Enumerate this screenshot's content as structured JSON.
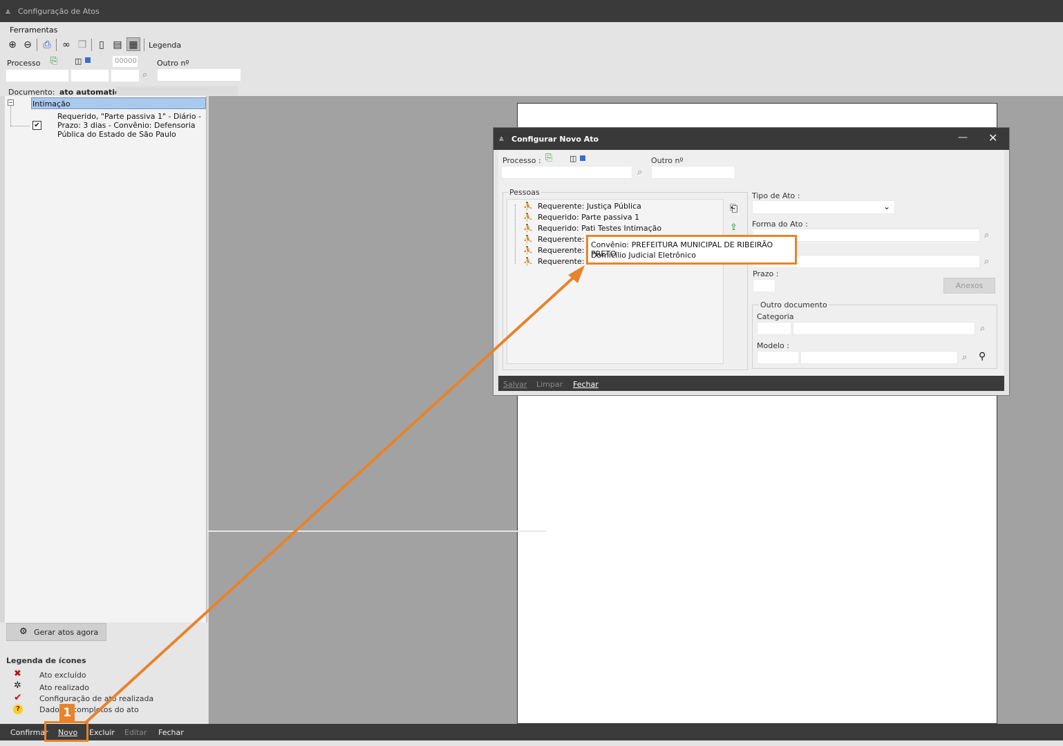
{
  "window": {
    "title": "Configuração de Atos"
  },
  "menu": {
    "ferramentas": "Ferramentas"
  },
  "toolbar": {
    "legend_label": "Legenda"
  },
  "search": {
    "processo_label": "Processo",
    "numero_value": "00000",
    "outro_label": "Outro nº"
  },
  "documento": {
    "label": "Documento:",
    "value": "ato automatico"
  },
  "tree": {
    "root_label": "Intimação",
    "child_lines": [
      "Requerido, \"Parte passiva 1\" - Diário -",
      "Prazo: 3 dias - Convênio: Defensoria",
      "Pública do Estado de São Paulo"
    ]
  },
  "left_actions": {
    "gerar": "Gerar atos agora"
  },
  "legend": {
    "title": "Legenda de ícones",
    "items": [
      {
        "icon": "x-icon",
        "label": "Ato excluído"
      },
      {
        "icon": "gear-icon",
        "label": "Ato realizado"
      },
      {
        "icon": "check-icon",
        "label": "Configuração de ato realizada"
      },
      {
        "icon": "question-icon",
        "label": "Dados incompletos do ato"
      }
    ]
  },
  "bottom": {
    "confirmar": "Confirmar",
    "novo": "Novo",
    "excluir": "Excluir",
    "editar": "Editar",
    "fechar": "Fechar"
  },
  "dialog": {
    "title": "Configurar Novo Ato",
    "processo_label": "Processo :",
    "outro_label": "Outro nº",
    "pessoas_label": "Pessoas",
    "people": [
      "Requerente: Justiça Pública",
      "Requerido: Parte passiva 1",
      "Requerido: Pati Testes Intimação",
      "Requerente: te",
      "Requerente: M",
      "Requerente: L"
    ],
    "tipo_label": "Tipo de Ato :",
    "forma_label": "Forma do Ato :",
    "prazo_label": "Prazo :",
    "anexos_label": "Anexos",
    "outro_doc_label": "Outro documento",
    "categoria_label": "Categoria",
    "modelo_label": "Modelo :",
    "footer": {
      "salvar": "Salvar",
      "limpar": "Limpar",
      "fechar": "Fechar"
    }
  },
  "tooltip": {
    "line1": "Convênio: PREFEITURA MUNICIPAL DE RIBEIRÃO PRETO",
    "line2": "Domicílio Judicial Eletrônico"
  },
  "annotation": {
    "step": "1",
    "color": "#e8832a"
  }
}
